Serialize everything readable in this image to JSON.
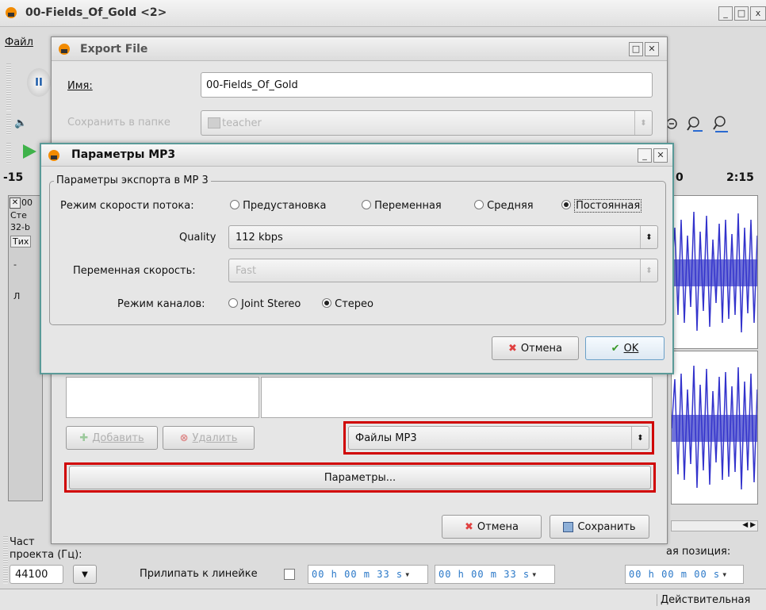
{
  "main_window": {
    "title": "00-Fields_Of_Gold <2>",
    "menu_file": "Файл",
    "ruler": {
      "left": "-15",
      "r1": "0",
      "r2": "2:15"
    },
    "track_labels": [
      "00",
      "Сте",
      "32-b",
      "Тих",
      "-",
      "Л"
    ],
    "bottom_left_l1": "Част",
    "bottom_left_l2": "проекта (Гц):",
    "rate_value": "44100",
    "snap_label": "Прилипать к линейке",
    "time1": "00 h 00 m 33 s",
    "time2": "00 h 00 m 33 s",
    "time3": "00 h 00 m 00 s",
    "position_label": "ая позиция:",
    "status_text": "Действительная"
  },
  "export_dialog": {
    "title": "Export File",
    "name_label": "Имя:",
    "name_value": "00-Fields_Of_Gold",
    "folder_label": "Сохранить в папке",
    "folder_value": "teacher",
    "add_button": "Добавить",
    "remove_button": "Удалить",
    "filetype_value": "Файлы MP3",
    "options_button": "Параметры...",
    "cancel_button": "Отмена",
    "save_button": "Сохранить"
  },
  "mp3_dialog": {
    "title": "Параметры MP3",
    "group_label": "Параметры экспорта в MP 3",
    "bitrate_mode_label": "Режим скорости потока:",
    "bitrate_modes": [
      "Предустановка",
      "Переменная",
      "Средняя",
      "Постоянная"
    ],
    "bitrate_mode_selected": "Постоянная",
    "quality_label": "Quality",
    "quality_value": "112 kbps",
    "variable_speed_label": "Переменная скорость:",
    "variable_speed_value": "Fast",
    "channel_mode_label": "Режим каналов:",
    "channel_modes": [
      "Joint Stereo",
      "Стерео"
    ],
    "channel_mode_selected": "Стерео",
    "cancel_button": "Отмена",
    "ok_button": "OK"
  },
  "colors": {
    "waveform": "#3333cc",
    "highlight": "#d00000",
    "time_text": "#2a78c8"
  }
}
